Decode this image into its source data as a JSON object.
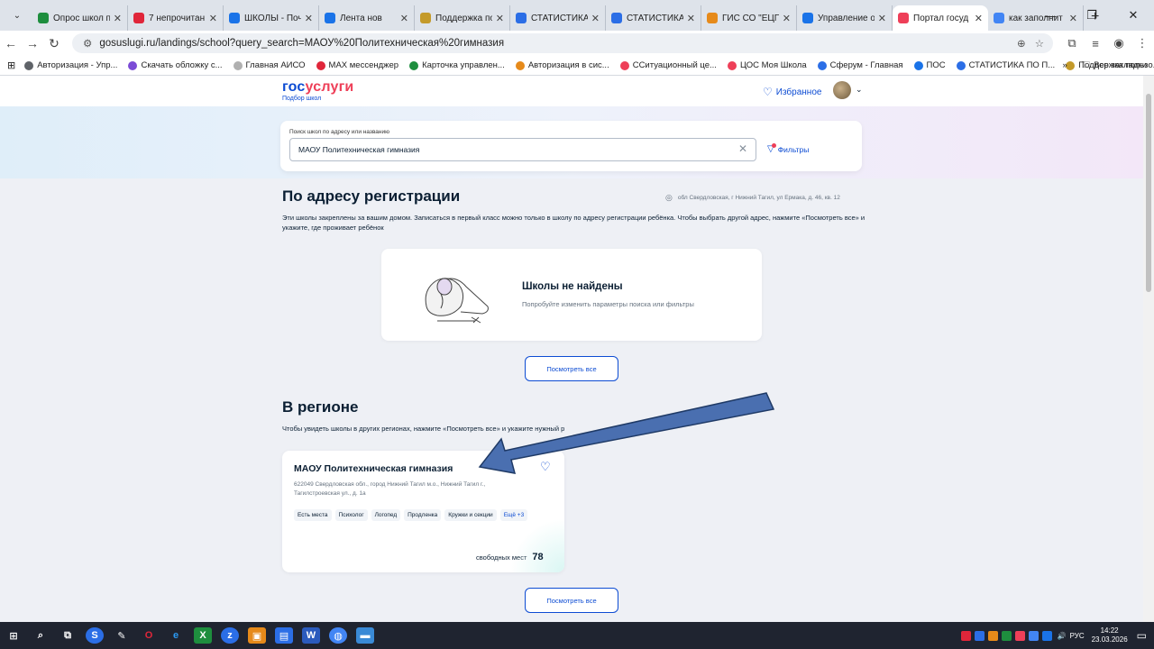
{
  "browser": {
    "tabs": [
      {
        "title": "Опрос школ п",
        "color": "#1e8e3e"
      },
      {
        "title": "7 непрочитан",
        "color": "#e0263a"
      },
      {
        "title": "ШКОЛЫ - Поч",
        "color": "#1a73e8"
      },
      {
        "title": "Лента нов",
        "color": "#1a73e8"
      },
      {
        "title": "Поддержка по",
        "color": "#c49a2a"
      },
      {
        "title": "СТАТИСТИКА",
        "color": "#2b6ee6"
      },
      {
        "title": "СТАТИСТИКА",
        "color": "#2b6ee6"
      },
      {
        "title": "ГИС СО \"ЕЦП\"",
        "color": "#e68a1a"
      },
      {
        "title": "Управление о",
        "color": "#1a73e8"
      },
      {
        "title": "Портал госуд",
        "color": "#ee3f58",
        "active": true
      },
      {
        "title": "как заполнит",
        "color": "#4285f4"
      }
    ],
    "url": "gosuslugi.ru/landings/school?query_search=МАОУ%20Политехническая%20гимназия",
    "bookmarks": [
      {
        "label": "Авторизация - Упр...",
        "color": "#5f6368"
      },
      {
        "label": "Скачать обложку с...",
        "color": "#7b4bd6"
      },
      {
        "label": "Главная АИСО",
        "color": "#b0b0b0"
      },
      {
        "label": "MAX мессенджер",
        "color": "#e0263a"
      },
      {
        "label": "Карточка управлен...",
        "color": "#1e8e3e"
      },
      {
        "label": "Авторизация в сис...",
        "color": "#e68a1a"
      },
      {
        "label": "ССитуационный це...",
        "color": "#ee3f58"
      },
      {
        "label": "ЦОС Моя Школа",
        "color": "#ee3f58"
      },
      {
        "label": "Сферум - Главная",
        "color": "#2b6ee6"
      },
      {
        "label": "ПОС",
        "color": "#1a73e8"
      },
      {
        "label": "СТАТИСТИКА ПО П...",
        "color": "#2b6ee6"
      },
      {
        "label": "Поддержка пользо...",
        "color": "#c49a2a"
      }
    ],
    "bookmarks_more": "»",
    "all_bookmarks": "Все закладки"
  },
  "header": {
    "logo_a": "гос",
    "logo_b": "услуги",
    "logo_sub": "Подбор школ",
    "favorites": "Избранное"
  },
  "search": {
    "label": "Поиск школ по адресу или названию",
    "value": "МАОУ Политехническая гимназия",
    "filters": "Фильтры"
  },
  "registration": {
    "title": "По адресу регистрации",
    "address": "обл Свердловская, г Нижний Тагил, ул Ермака, д. 46, кв. 12",
    "description": "Эти школы закреплены за вашим домом. Записаться в первый класс можно только в школу по адресу регистрации ребёнка. Чтобы выбрать другой адрес, нажмите «Посмотреть все» и укажите, где проживает ребёнок",
    "empty_title": "Школы не найдены",
    "empty_sub": "Попробуйте изменить параметры поиска или фильтры",
    "view_all": "Посмотреть все"
  },
  "region": {
    "title": "В регионе",
    "description": "Чтобы увидеть школы в других регионах, нажмите «Посмотреть все» и укажите нужный р",
    "view_all": "Посмотреть все",
    "school": {
      "name": "МАОУ Политехническая гимназия",
      "address": "622049 Свердловская обл., город Нижний Тагил м.о., Нижний Тагил г., Тагилстроевская ул., д. 1а",
      "tags": [
        "Есть места",
        "Психолог",
        "Логопед",
        "Продленка",
        "Кружки и секции"
      ],
      "more": "Ещё +3",
      "free_label": "свободных мест",
      "free_count": "78"
    }
  },
  "taskbar": {
    "lang": "РУС",
    "time": "14:22",
    "date": "23.03.2026"
  },
  "colors": {
    "brand_blue": "#0d4cd3",
    "brand_red": "#ee3f58",
    "arrow": "#4a6fb0"
  }
}
